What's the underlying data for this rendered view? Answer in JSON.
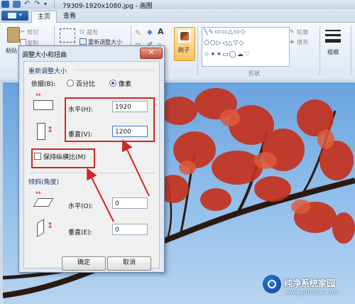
{
  "window": {
    "title": "79309-1920x1080.jpg - 画图"
  },
  "ribbon": {
    "tabs": [
      {
        "label": "主页"
      },
      {
        "label": "查看"
      }
    ],
    "clipboard": {
      "paste": "粘贴",
      "cut": "剪切",
      "copy": "复制"
    },
    "image": {
      "crop": "裁剪",
      "resize": "重新调整大小"
    },
    "tools": {
      "brush": "刷子"
    },
    "shapes": {
      "outline": "轮廓",
      "fill": "填充",
      "group_label": "形状"
    },
    "size": {
      "label": "粗细"
    }
  },
  "dialog": {
    "title": "调整大小和扭曲",
    "close_glyph": "✕",
    "resize_section": "重新调整大小",
    "by_label": "依据(B):",
    "percent_label": "百分比",
    "pixel_label": "像素",
    "selected_unit": "像素",
    "horizontal_label": "水平(H):",
    "horizontal_value": "1920",
    "vertical_label": "垂直(V):",
    "vertical_value": "1200",
    "keep_ratio_label": "保持纵横比(M)",
    "keep_ratio_checked": false,
    "skew_section": "倾斜(角度)",
    "skew_horizontal_label": "水平(O):",
    "skew_horizontal_value": "0",
    "skew_vertical_label": "垂直(E):",
    "skew_vertical_value": "0",
    "ok_label": "确定",
    "cancel_label": "取消"
  },
  "watermark": {
    "text": "纯净系统家园",
    "url": "www.yidaimei.com"
  },
  "colors": {
    "annotation_red": "#d42525",
    "dialog_bg": "#dfe8f3",
    "sky_blue": "#7fb2e6",
    "leaf_red": "#c4321f"
  }
}
